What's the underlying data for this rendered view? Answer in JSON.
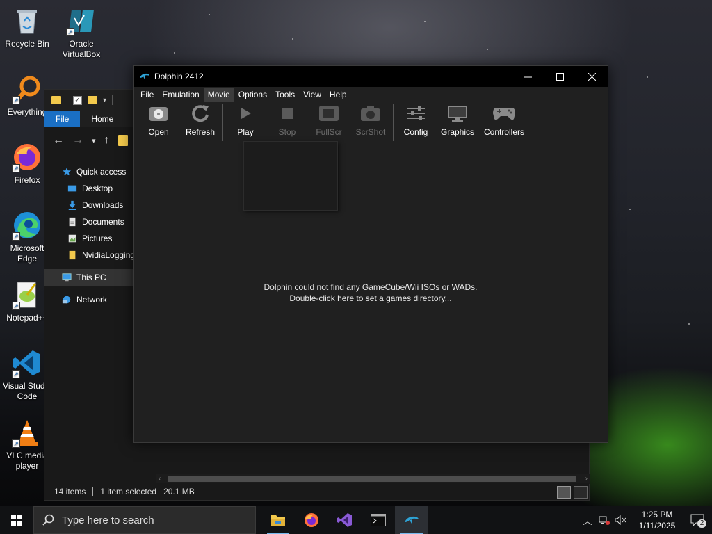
{
  "desktop": {
    "icons": [
      {
        "label": "Recycle Bin"
      },
      {
        "label": "Oracle VirtualBox"
      },
      {
        "label": "Everything"
      },
      {
        "label": "Firefox"
      },
      {
        "label": "Microsoft Edge"
      },
      {
        "label": "Notepad++"
      },
      {
        "label": "Visual Studio Code"
      },
      {
        "label": "VLC media player"
      }
    ]
  },
  "explorer": {
    "ribbon_tabs": [
      "File",
      "Home"
    ],
    "nav": {
      "quick_access": "Quick access",
      "items": [
        "Desktop",
        "Downloads",
        "Documents",
        "Pictures",
        "NvidiaLogging"
      ],
      "this_pc": "This PC",
      "network": "Network"
    },
    "status": {
      "items_count": "14 items",
      "selection": "1 item selected",
      "size": "20.1 MB"
    }
  },
  "dolphin": {
    "title": "Dolphin 2412",
    "menu": [
      "File",
      "Emulation",
      "Movie",
      "Options",
      "Tools",
      "View",
      "Help"
    ],
    "active_menu": "Movie",
    "toolbar": {
      "open": "Open",
      "refresh": "Refresh",
      "play": "Play",
      "stop": "Stop",
      "fullscreen": "FullScr",
      "screenshot": "ScrShot",
      "config": "Config",
      "graphics": "Graphics",
      "controllers": "Controllers"
    },
    "empty_message_line1": "Dolphin could not find any GameCube/Wii ISOs or WADs.",
    "empty_message_line2": "Double-click here to set a games directory..."
  },
  "taskbar": {
    "search_placeholder": "Type here to search",
    "time": "1:25 PM",
    "date": "1/11/2025",
    "notification_count": "2"
  },
  "colors": {
    "accent": "#1a6fc4",
    "dolphin_blue": "#2ea3d6",
    "taskbar_indicator": "#76b9ed"
  }
}
